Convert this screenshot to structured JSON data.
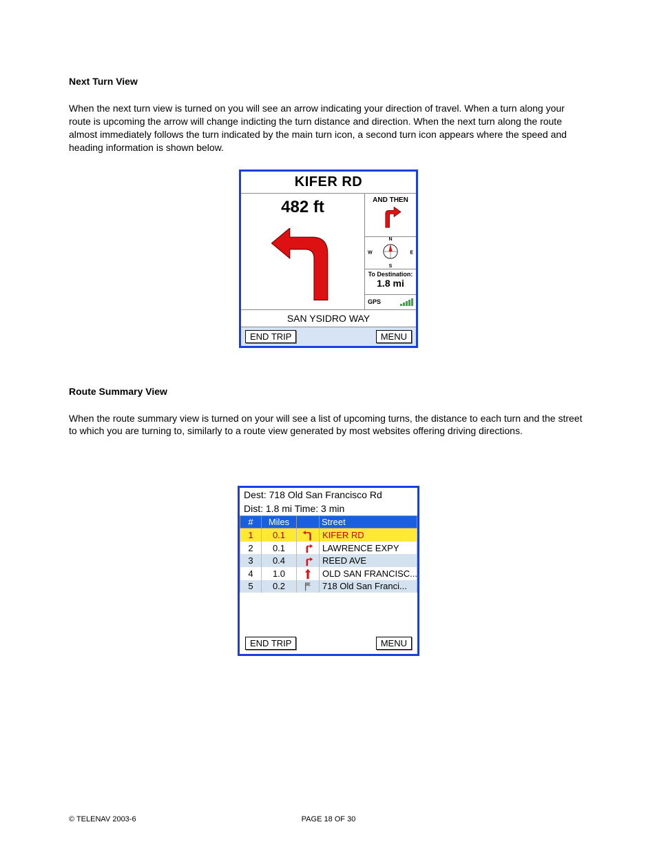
{
  "section1": {
    "heading": "Next Turn View",
    "body": "When the next turn view is turned on you will see an arrow indicating your direction of travel.  When a turn along your route is upcoming the arrow will change indicting the turn distance and direction.  When the next turn along the route almost immediately follows the turn indicated by the main turn icon, a second turn icon appears where the speed and heading information is shown below."
  },
  "next_turn": {
    "street_ahead": "KIFER RD",
    "distance": "482 ft",
    "and_then_label": "AND THEN",
    "compass_dirs": {
      "n": "N",
      "e": "E",
      "s": "S",
      "w": "W"
    },
    "to_dest_label": "To Destination:",
    "to_dest_value": "1.8 mi",
    "gps_label": "GPS",
    "current_street": "SAN YSIDRO WAY",
    "btn_end": "END TRIP",
    "btn_menu": "MENU"
  },
  "section2": {
    "heading": "Route Summary View",
    "body": "When the route summary view is turned on your will see a list of upcoming turns, the distance to each turn and the street to which you are turning to, similarly to a route view generated by most websites offering driving directions."
  },
  "route_summary": {
    "dest_line": "Dest: 718 Old San Francisco Rd",
    "dist_line": "Dist: 1.8 mi Time: 3 min",
    "columns": {
      "num": "#",
      "miles": "Miles",
      "icon": "",
      "street": "Street"
    },
    "rows": [
      {
        "n": "1",
        "mi": "0.1",
        "icon": "left",
        "street": "KIFER RD",
        "hl": true
      },
      {
        "n": "2",
        "mi": "0.1",
        "icon": "right",
        "street": "LAWRENCE EXPY",
        "hl": false
      },
      {
        "n": "3",
        "mi": "0.4",
        "icon": "right",
        "street": "REED AVE",
        "hl": false
      },
      {
        "n": "4",
        "mi": "1.0",
        "icon": "straight",
        "street": "OLD SAN FRANCISC...",
        "hl": false
      },
      {
        "n": "5",
        "mi": "0.2",
        "icon": "flag",
        "street": "718 Old San Franci...",
        "hl": false
      }
    ],
    "btn_end": "END TRIP",
    "btn_menu": "MENU"
  },
  "footer": {
    "copyright": "© TELENAV 2003-6",
    "page": "PAGE 18 OF 30"
  }
}
